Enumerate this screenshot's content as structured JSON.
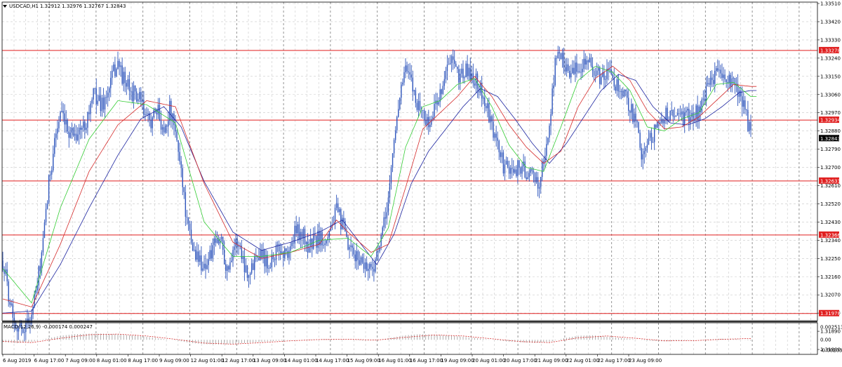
{
  "header": {
    "symbol_label": "USDCAD,H1",
    "ohlc_text": "1.32912 1.32976 1.32767 1.32843",
    "menu_icon": "triangle-down-icon"
  },
  "macd_header": {
    "label": "MACD(12,26,9) -0.000174 0.000247"
  },
  "colors": {
    "candle": "#2f56bc",
    "ma_fast": "#33cc33",
    "ma_mid": "#d52b2b",
    "ma_slow": "#1c24a0",
    "level_line": "#e01f1f",
    "grid": "#c8c8c8",
    "frame": "#000000",
    "macd_hist": "#9a9a9a",
    "macd_signal": "#d52b2b",
    "price_tag_bg": "#000000",
    "level_tag_bg": "#e01f1f"
  },
  "chart_data": {
    "type": "candlestick",
    "symbol": "USDCAD",
    "timeframe": "H1",
    "ylim": [
      1.318,
      1.3351
    ],
    "price_ticks": [
      "1.33510",
      "1.33420",
      "1.33330",
      "1.33240",
      "1.33150",
      "1.33060",
      "1.32970",
      "1.32880",
      "1.32790",
      "1.32700",
      "1.32610",
      "1.32520",
      "1.32430",
      "1.32340",
      "1.32250",
      "1.32160",
      "1.32070",
      "1.31980",
      "1.31890",
      "1.31800"
    ],
    "time_labels": [
      "6 Aug 2019",
      "6 Aug 17:00",
      "7 Aug 09:00",
      "8 Aug 01:00",
      "8 Aug 17:00",
      "9 Aug 09:00",
      "12 Aug 01:00",
      "12 Aug 17:00",
      "13 Aug 09:00",
      "14 Aug 01:00",
      "14 Aug 17:00",
      "15 Aug 09:00",
      "16 Aug 01:00",
      "16 Aug 17:00",
      "19 Aug 09:00",
      "20 Aug 01:00",
      "20 Aug 17:00",
      "21 Aug 09:00",
      "22 Aug 01:00",
      "22 Aug 17:00",
      "23 Aug 09:00"
    ],
    "horizontal_levels": [
      "1.33278",
      "1.32934",
      "1.32633",
      "1.32366",
      "1.31978"
    ],
    "current_price": "1.32843",
    "price_path": [
      [
        0,
        1.3224
      ],
      [
        4,
        1.3208
      ],
      [
        8,
        1.3195
      ],
      [
        12,
        1.319
      ],
      [
        16,
        1.3192
      ],
      [
        20,
        1.3197
      ],
      [
        24,
        1.3212
      ],
      [
        28,
        1.3232
      ],
      [
        32,
        1.3262
      ],
      [
        36,
        1.3284
      ],
      [
        40,
        1.3296
      ],
      [
        44,
        1.3289
      ],
      [
        48,
        1.3288
      ],
      [
        52,
        1.3287
      ],
      [
        56,
        1.329
      ],
      [
        60,
        1.3298
      ],
      [
        64,
        1.3307
      ],
      [
        68,
        1.3301
      ],
      [
        72,
        1.3304
      ],
      [
        76,
        1.3315
      ],
      [
        80,
        1.3322
      ],
      [
        84,
        1.3313
      ],
      [
        88,
        1.3308
      ],
      [
        92,
        1.3306
      ],
      [
        96,
        1.3302
      ],
      [
        100,
        1.3293
      ],
      [
        104,
        1.3294
      ],
      [
        108,
        1.3297
      ],
      [
        112,
        1.3288
      ],
      [
        116,
        1.3299
      ],
      [
        120,
        1.3286
      ],
      [
        124,
        1.327
      ],
      [
        128,
        1.3242
      ],
      [
        132,
        1.323
      ],
      [
        136,
        1.3225
      ],
      [
        140,
        1.3221
      ],
      [
        144,
        1.3226
      ],
      [
        148,
        1.3232
      ],
      [
        152,
        1.3235
      ],
      [
        156,
        1.3218
      ],
      [
        160,
        1.3231
      ],
      [
        164,
        1.3233
      ],
      [
        168,
        1.3222
      ],
      [
        172,
        1.3217
      ],
      [
        176,
        1.3229
      ],
      [
        180,
        1.3228
      ],
      [
        184,
        1.3223
      ],
      [
        188,
        1.3226
      ],
      [
        192,
        1.323
      ],
      [
        196,
        1.3227
      ],
      [
        200,
        1.323
      ],
      [
        204,
        1.3239
      ],
      [
        208,
        1.3237
      ],
      [
        212,
        1.3231
      ],
      [
        216,
        1.3233
      ],
      [
        220,
        1.3235
      ],
      [
        224,
        1.3235
      ],
      [
        228,
        1.3241
      ],
      [
        232,
        1.3248
      ],
      [
        236,
        1.3242
      ],
      [
        240,
        1.323
      ],
      [
        244,
        1.3226
      ],
      [
        248,
        1.3225
      ],
      [
        252,
        1.3222
      ],
      [
        256,
        1.322
      ],
      [
        260,
        1.3225
      ],
      [
        264,
        1.3237
      ],
      [
        268,
        1.3255
      ],
      [
        272,
        1.3283
      ],
      [
        276,
        1.3307
      ],
      [
        280,
        1.3318
      ],
      [
        284,
        1.3312
      ],
      [
        288,
        1.3302
      ],
      [
        292,
        1.3297
      ],
      [
        296,
        1.329
      ],
      [
        300,
        1.3299
      ],
      [
        304,
        1.3307
      ],
      [
        308,
        1.3317
      ],
      [
        312,
        1.3323
      ],
      [
        316,
        1.3315
      ],
      [
        320,
        1.3317
      ],
      [
        324,
        1.3317
      ],
      [
        328,
        1.3314
      ],
      [
        332,
        1.3309
      ],
      [
        336,
        1.33
      ],
      [
        340,
        1.3289
      ],
      [
        344,
        1.3281
      ],
      [
        348,
        1.3271
      ],
      [
        352,
        1.3268
      ],
      [
        356,
        1.327
      ],
      [
        360,
        1.327
      ],
      [
        364,
        1.3268
      ],
      [
        368,
        1.3265
      ],
      [
        372,
        1.3262
      ],
      [
        376,
        1.3272
      ],
      [
        380,
        1.329
      ],
      [
        384,
        1.3323
      ],
      [
        388,
        1.3325
      ],
      [
        392,
        1.332
      ],
      [
        396,
        1.3316
      ],
      [
        400,
        1.3319
      ],
      [
        404,
        1.3324
      ],
      [
        408,
        1.3321
      ],
      [
        412,
        1.3316
      ],
      [
        416,
        1.3314
      ],
      [
        420,
        1.3316
      ],
      [
        424,
        1.3314
      ],
      [
        428,
        1.331
      ],
      [
        432,
        1.3305
      ],
      [
        436,
        1.3301
      ],
      [
        440,
        1.3292
      ],
      [
        444,
        1.3278
      ],
      [
        448,
        1.328
      ],
      [
        452,
        1.3287
      ],
      [
        456,
        1.329
      ],
      [
        460,
        1.3297
      ],
      [
        464,
        1.3295
      ],
      [
        468,
        1.3297
      ],
      [
        472,
        1.3294
      ],
      [
        476,
        1.3295
      ],
      [
        480,
        1.3296
      ],
      [
        484,
        1.3298
      ],
      [
        488,
        1.3305
      ],
      [
        492,
        1.3313
      ],
      [
        496,
        1.3318
      ],
      [
        500,
        1.3314
      ],
      [
        504,
        1.3313
      ],
      [
        508,
        1.331
      ],
      [
        512,
        1.3305
      ],
      [
        516,
        1.33
      ],
      [
        520,
        1.3284
      ]
    ],
    "ma_fast_path": [
      [
        0,
        1.322
      ],
      [
        20,
        1.3203
      ],
      [
        40,
        1.325
      ],
      [
        60,
        1.3284
      ],
      [
        80,
        1.3303
      ],
      [
        100,
        1.3301
      ],
      [
        120,
        1.3292
      ],
      [
        140,
        1.3243
      ],
      [
        160,
        1.3226
      ],
      [
        180,
        1.3226
      ],
      [
        200,
        1.3228
      ],
      [
        220,
        1.3234
      ],
      [
        240,
        1.3235
      ],
      [
        256,
        1.3226
      ],
      [
        268,
        1.324
      ],
      [
        280,
        1.328
      ],
      [
        292,
        1.33
      ],
      [
        304,
        1.3303
      ],
      [
        316,
        1.3311
      ],
      [
        328,
        1.3314
      ],
      [
        340,
        1.33
      ],
      [
        352,
        1.3281
      ],
      [
        364,
        1.327
      ],
      [
        376,
        1.3268
      ],
      [
        388,
        1.329
      ],
      [
        400,
        1.3313
      ],
      [
        412,
        1.332
      ],
      [
        424,
        1.3317
      ],
      [
        436,
        1.3308
      ],
      [
        448,
        1.329
      ],
      [
        460,
        1.3288
      ],
      [
        472,
        1.3294
      ],
      [
        484,
        1.3297
      ],
      [
        496,
        1.3311
      ],
      [
        508,
        1.3312
      ],
      [
        520,
        1.3305
      ]
    ],
    "ma_mid_path": [
      [
        0,
        1.3205
      ],
      [
        20,
        1.3201
      ],
      [
        40,
        1.3232
      ],
      [
        60,
        1.3268
      ],
      [
        80,
        1.3291
      ],
      [
        100,
        1.3303
      ],
      [
        120,
        1.33
      ],
      [
        140,
        1.3262
      ],
      [
        160,
        1.3233
      ],
      [
        180,
        1.3225
      ],
      [
        200,
        1.3228
      ],
      [
        220,
        1.3232
      ],
      [
        232,
        1.3244
      ],
      [
        240,
        1.3238
      ],
      [
        256,
        1.3228
      ],
      [
        268,
        1.3232
      ],
      [
        280,
        1.326
      ],
      [
        292,
        1.3289
      ],
      [
        304,
        1.3297
      ],
      [
        316,
        1.3305
      ],
      [
        328,
        1.3315
      ],
      [
        340,
        1.3305
      ],
      [
        352,
        1.3291
      ],
      [
        364,
        1.328
      ],
      [
        376,
        1.3272
      ],
      [
        388,
        1.3278
      ],
      [
        400,
        1.33
      ],
      [
        412,
        1.3314
      ],
      [
        424,
        1.332
      ],
      [
        436,
        1.3313
      ],
      [
        448,
        1.3298
      ],
      [
        460,
        1.3289
      ],
      [
        472,
        1.329
      ],
      [
        484,
        1.3295
      ],
      [
        496,
        1.3303
      ],
      [
        508,
        1.3311
      ],
      [
        520,
        1.331
      ]
    ],
    "ma_slow_path": [
      [
        0,
        1.3198
      ],
      [
        20,
        1.3199
      ],
      [
        40,
        1.3222
      ],
      [
        60,
        1.325
      ],
      [
        80,
        1.3276
      ],
      [
        96,
        1.3294
      ],
      [
        112,
        1.33
      ],
      [
        124,
        1.329
      ],
      [
        140,
        1.3263
      ],
      [
        160,
        1.3238
      ],
      [
        180,
        1.3229
      ],
      [
        200,
        1.3233
      ],
      [
        220,
        1.3238
      ],
      [
        236,
        1.3244
      ],
      [
        248,
        1.3233
      ],
      [
        260,
        1.3222
      ],
      [
        272,
        1.3237
      ],
      [
        284,
        1.3262
      ],
      [
        296,
        1.3278
      ],
      [
        308,
        1.3289
      ],
      [
        320,
        1.33
      ],
      [
        332,
        1.3309
      ],
      [
        344,
        1.3305
      ],
      [
        356,
        1.3294
      ],
      [
        368,
        1.3282
      ],
      [
        380,
        1.3272
      ],
      [
        392,
        1.3282
      ],
      [
        404,
        1.3295
      ],
      [
        416,
        1.3308
      ],
      [
        428,
        1.3316
      ],
      [
        440,
        1.3313
      ],
      [
        452,
        1.33
      ],
      [
        464,
        1.3292
      ],
      [
        476,
        1.3291
      ],
      [
        488,
        1.3294
      ],
      [
        500,
        1.33
      ],
      [
        512,
        1.3307
      ],
      [
        520,
        1.3308
      ]
    ],
    "macd": {
      "ylim": [
        -0.002036,
        0.002513
      ],
      "ticks": [
        "0.002513",
        "0.00",
        "-0.002036"
      ],
      "current_value": "-0.000174",
      "signal_value": "0.000247",
      "hist_path": [
        [
          0,
          -0.00045
        ],
        [
          10,
          -0.00065
        ],
        [
          20,
          -0.0004
        ],
        [
          30,
          0.0002
        ],
        [
          40,
          0.0008
        ],
        [
          50,
          0.0011
        ],
        [
          60,
          0.0012
        ],
        [
          70,
          0.0012
        ],
        [
          80,
          0.0011
        ],
        [
          90,
          0.00085
        ],
        [
          100,
          0.0006
        ],
        [
          110,
          0.0002
        ],
        [
          120,
          -0.0001
        ],
        [
          130,
          -0.0006
        ],
        [
          140,
          -0.00085
        ],
        [
          150,
          -0.0009
        ],
        [
          160,
          -0.0008
        ],
        [
          170,
          -0.0006
        ],
        [
          180,
          -0.0004
        ],
        [
          190,
          -0.0002
        ],
        [
          200,
          -5e-05
        ],
        [
          210,
          5e-05
        ],
        [
          220,
          0.0001
        ],
        [
          230,
          0.00015
        ],
        [
          240,
          5e-05
        ],
        [
          250,
          -0.00015
        ],
        [
          260,
          -0.0001
        ],
        [
          270,
          0.0004
        ],
        [
          280,
          0.0009
        ],
        [
          290,
          0.0011
        ],
        [
          300,
          0.001
        ],
        [
          310,
          0.0008
        ],
        [
          320,
          0.0006
        ],
        [
          330,
          0.0003
        ],
        [
          340,
          0.0
        ],
        [
          350,
          -0.0003
        ],
        [
          360,
          -0.0005
        ],
        [
          370,
          -0.0006
        ],
        [
          380,
          -0.0004
        ],
        [
          390,
          0.0003
        ],
        [
          400,
          0.0008
        ],
        [
          410,
          0.0009
        ],
        [
          420,
          0.0006
        ],
        [
          430,
          0.00035
        ],
        [
          440,
          5e-05
        ],
        [
          450,
          -0.0002
        ],
        [
          460,
          -0.0003
        ],
        [
          470,
          -0.0002
        ],
        [
          480,
          -5e-05
        ],
        [
          490,
          0.0001
        ],
        [
          500,
          0.0002
        ],
        [
          510,
          0.00015
        ],
        [
          520,
          -0.00017
        ]
      ],
      "signal_path": [
        [
          0,
          -0.0003
        ],
        [
          20,
          -0.00055
        ],
        [
          40,
          0.0003
        ],
        [
          60,
          0.001
        ],
        [
          80,
          0.00112
        ],
        [
          100,
          0.00075
        ],
        [
          120,
          0.0001
        ],
        [
          140,
          -0.00065
        ],
        [
          160,
          -0.00085
        ],
        [
          180,
          -0.00055
        ],
        [
          200,
          -0.0002
        ],
        [
          220,
          5e-05
        ],
        [
          240,
          0.0001
        ],
        [
          260,
          -5e-05
        ],
        [
          280,
          0.0005
        ],
        [
          300,
          0.00095
        ],
        [
          320,
          0.00075
        ],
        [
          340,
          0.0002
        ],
        [
          360,
          -0.00035
        ],
        [
          380,
          -0.00055
        ],
        [
          400,
          0.0004
        ],
        [
          420,
          0.00075
        ],
        [
          440,
          0.0003
        ],
        [
          460,
          -0.0002
        ],
        [
          480,
          -0.00018
        ],
        [
          500,
          0.0001
        ],
        [
          520,
          0.00025
        ]
      ]
    }
  }
}
